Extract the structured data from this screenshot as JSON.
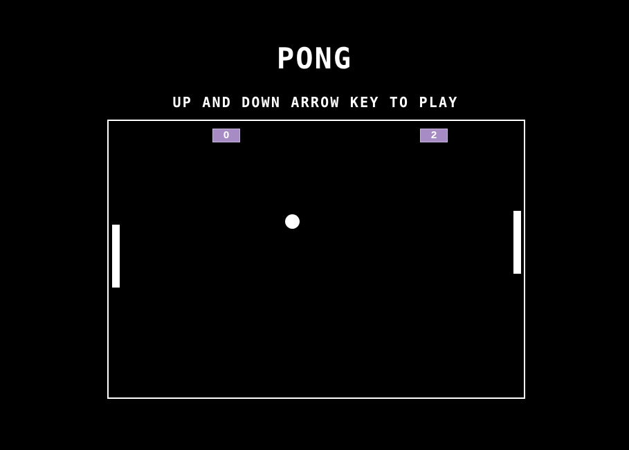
{
  "game": {
    "title": "PONG",
    "instructions": "UP AND DOWN ARROW KEY TO PLAY"
  },
  "scores": {
    "left": "0",
    "right": "2"
  },
  "colors": {
    "background": "#000000",
    "foreground": "#ffffff",
    "score_badge": "#a78bc4"
  }
}
